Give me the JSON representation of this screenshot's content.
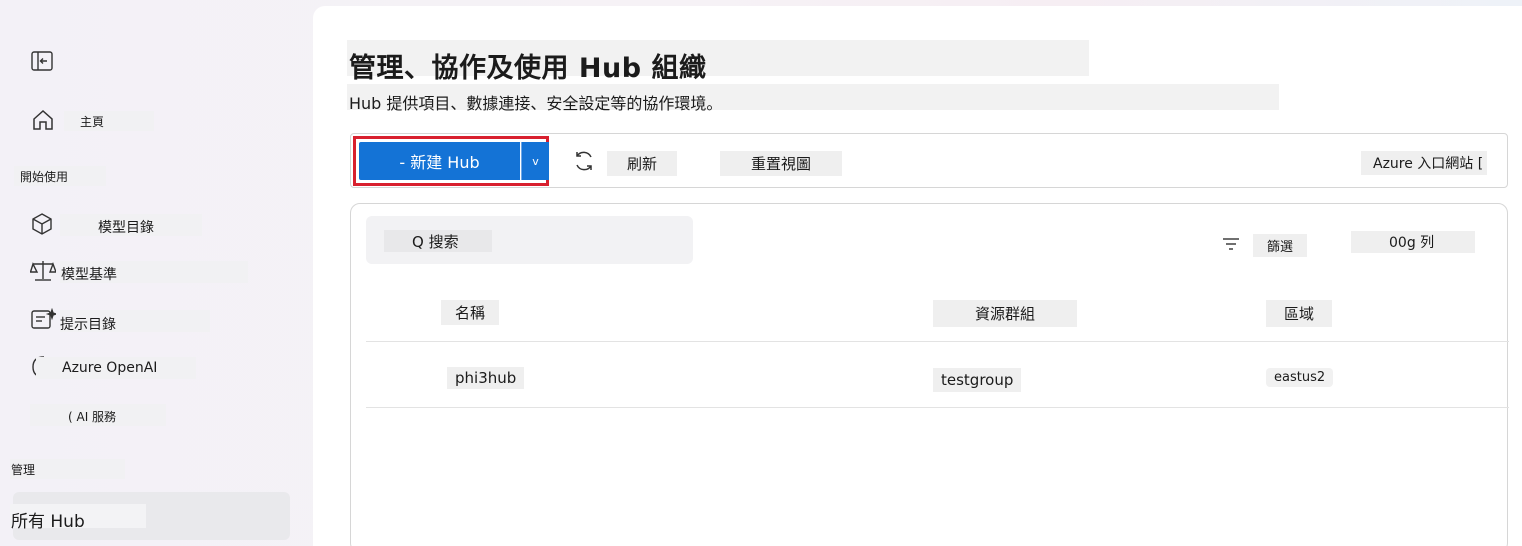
{
  "sidebar": {
    "home": "主頁",
    "section_getting_started": "開始使用",
    "items": [
      {
        "label": "模型目錄",
        "icon": "cube-icon"
      },
      {
        "label": "模型基準",
        "icon": "scale-icon"
      },
      {
        "label": "提示目錄",
        "icon": "prompt-catalog-icon"
      },
      {
        "label": "Azure OpenAI",
        "icon": "openai-icon"
      },
      {
        "label": "( AI 服務",
        "icon": "ai-services-icon"
      }
    ],
    "section_manage": "管理",
    "selected_item": "所有 Hub"
  },
  "main": {
    "title": "管理、協作及使用 Hub 組織",
    "subtitle": "Hub 提供項目、數據連接、安全設定等的協作環境。"
  },
  "toolbar": {
    "new_hub": "- 新建 Hub",
    "new_hub_caret": "v",
    "refresh": "刷新",
    "reset_view": "重置視圖",
    "azure_portal": "Azure 入口網站 ["
  },
  "table": {
    "search_placeholder": "Q 搜索",
    "filter": "篩選",
    "columns_menu": "00g 列",
    "headers": [
      "名稱",
      "資源群組",
      "區域"
    ],
    "rows": [
      {
        "name": "phi3hub",
        "resource_group": "testgroup",
        "region": "eastus2"
      }
    ]
  },
  "colors": {
    "accent": "#1473d6",
    "highlight_border": "#d8202e"
  }
}
